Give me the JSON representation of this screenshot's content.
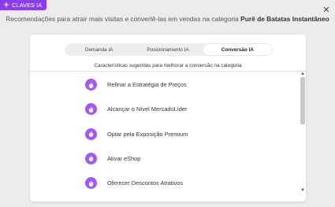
{
  "badge": {
    "label": "CLAVES IA",
    "icon": "ai-sparkle-icon"
  },
  "close_icon": "close-icon",
  "headline": {
    "prefix": "Recomendações para atrair mais visitas e convertê-las em vendas na categoria",
    "category": "Purê de Batatas Instantâneo"
  },
  "tabs": [
    {
      "label": "Demanda IA",
      "active": false
    },
    {
      "label": "Posicionamento IA",
      "active": false
    },
    {
      "label": "Conversão IA",
      "active": true
    }
  ],
  "subtitle": "Características sugeridas para melhorar a conversão na categoria",
  "items": [
    {
      "label": "Refinar a Estratégia de Preços",
      "icon": "flame-icon"
    },
    {
      "label": "Alcançar o Nível MercadoLíder",
      "icon": "flame-icon"
    },
    {
      "label": "Optar pela Exposição Premium",
      "icon": "flame-icon"
    },
    {
      "label": "Ativar eShop",
      "icon": "flame-icon"
    },
    {
      "label": "Oferecer Descontos Atrativos",
      "icon": "flame-icon"
    }
  ],
  "colors": {
    "accent": "#8a3cf0",
    "icon_bg": "#a259f5",
    "background": "#ececec"
  }
}
